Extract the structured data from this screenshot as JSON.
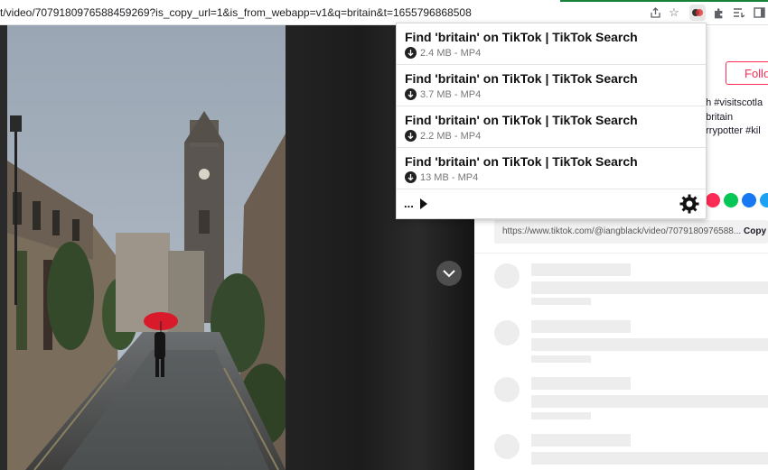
{
  "browser": {
    "url": "t/video/7079180976588459269?is_copy_url=1&is_from_webapp=v1&q=britain&t=1655796868508",
    "icons": [
      "share-icon",
      "star-icon",
      "extension-active-icon",
      "puzzle-icon",
      "reading-list-icon",
      "sidebar-icon"
    ]
  },
  "popup": {
    "items": [
      {
        "title": "Find 'britain' on TikTok | TikTok Search",
        "meta": "2.4 MB - MP4"
      },
      {
        "title": "Find 'britain' on TikTok | TikTok Search",
        "meta": "3.7 MB - MP4"
      },
      {
        "title": "Find 'britain' on TikTok | TikTok Search",
        "meta": "2.2 MB - MP4"
      },
      {
        "title": "Find 'britain' on TikTok | TikTok Search",
        "meta": "13 MB - MP4"
      }
    ],
    "footer": {
      "more_label": "..."
    }
  },
  "page": {
    "follow_label": "Follow",
    "hashtags": [
      "gh #visitscotla",
      "#britain",
      "arrypotter #kil"
    ],
    "share_colors": [
      "#fe2c55",
      "#06c755",
      "#1877f2",
      "#1da1f2"
    ],
    "link_text": "https://www.tiktok.com/@iangblack/video/7079180976588...",
    "copy_label": "Copy l"
  },
  "colors": {
    "accent": "#fe2c55",
    "address_progress": "#188038"
  }
}
